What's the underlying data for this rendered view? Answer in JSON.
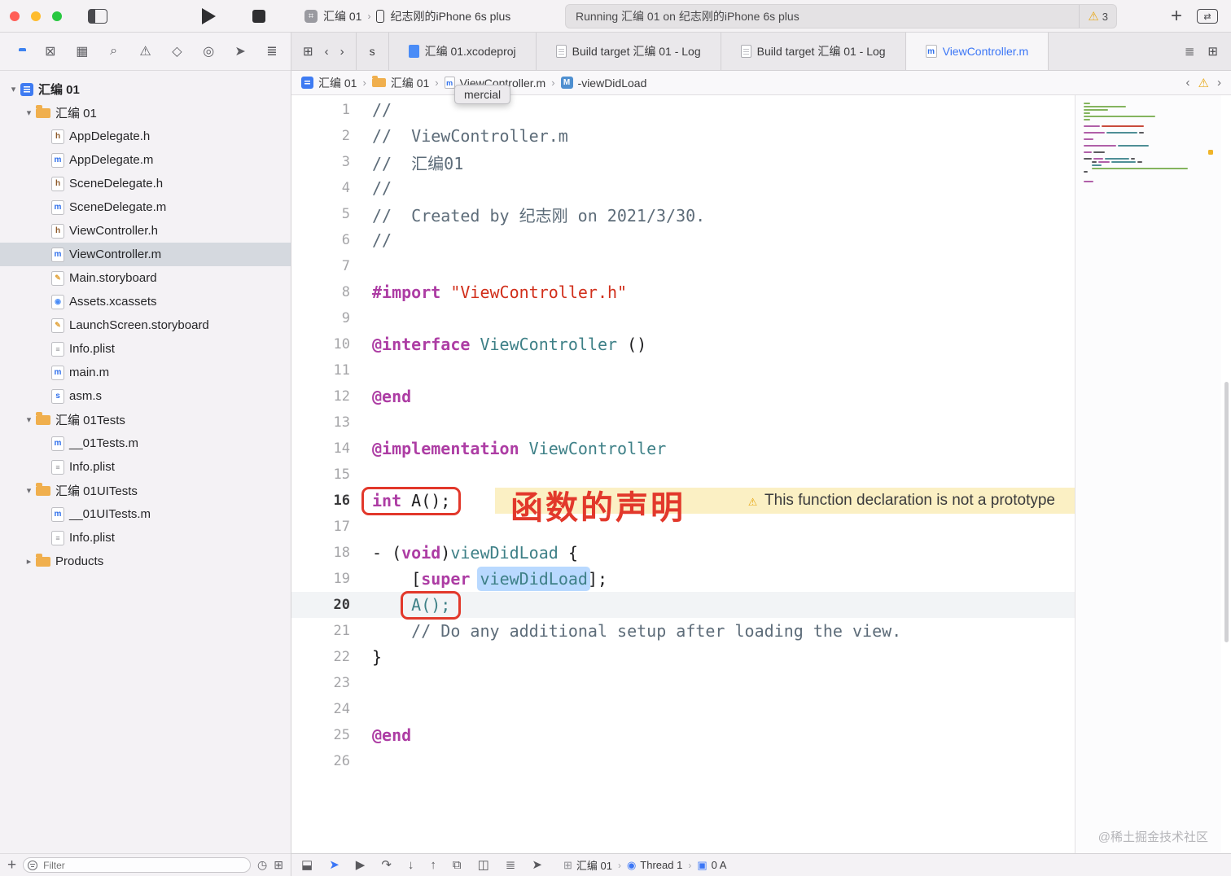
{
  "window": {
    "scheme": "汇编 01",
    "device": "纪志刚的iPhone 6s plus",
    "status_text": "Running 汇编 01 on 纪志刚的iPhone 6s plus",
    "warning_count": "3"
  },
  "navigator_icons": [
    {
      "name": "project-navigator-icon",
      "shape": "folder",
      "active": true
    },
    {
      "name": "source-control-navigator-icon",
      "glyph": "⊠"
    },
    {
      "name": "symbol-navigator-icon",
      "glyph": "▦"
    },
    {
      "name": "find-navigator-icon",
      "glyph": "⌕"
    },
    {
      "name": "issue-navigator-icon",
      "glyph": "⚠"
    },
    {
      "name": "test-navigator-icon",
      "glyph": "◇"
    },
    {
      "name": "debug-navigator-icon",
      "glyph": "◎"
    },
    {
      "name": "breakpoint-navigator-icon",
      "glyph": "➤"
    },
    {
      "name": "report-navigator-icon",
      "glyph": "≣"
    }
  ],
  "tab_bar": {
    "leading_icons": [
      {
        "name": "related-items-icon",
        "glyph": "⊞"
      },
      {
        "name": "back-chevron-icon",
        "glyph": "‹"
      },
      {
        "name": "forward-chevron-icon",
        "glyph": "›"
      }
    ],
    "tabs": [
      {
        "label": "s",
        "icon": "none"
      },
      {
        "label": "汇编 01.xcodeproj",
        "icon": "xcodeproj"
      },
      {
        "label": "Build target 汇编 01 - Log",
        "icon": "log"
      },
      {
        "label": "Build target 汇编 01 - Log",
        "icon": "log"
      },
      {
        "label": "ViewController.m",
        "icon": "mfile",
        "active": true
      }
    ],
    "trailing_icons": [
      {
        "name": "adjust-editor-icon",
        "glyph": "≣"
      },
      {
        "name": "add-editor-icon",
        "glyph": "⊞"
      }
    ]
  },
  "jump_bar": {
    "items": [
      {
        "label": "汇编 01",
        "icon": "project"
      },
      {
        "label": "汇编 01",
        "icon": "folder"
      },
      {
        "label": "ViewController.m",
        "icon": "mfile"
      },
      {
        "label": "-viewDidLoad",
        "icon": "method"
      }
    ],
    "trailing": [
      {
        "name": "previous-issue-icon",
        "glyph": "‹"
      },
      {
        "name": "issue-warning-icon",
        "glyph": "⚠"
      },
      {
        "name": "next-issue-icon",
        "glyph": "›"
      }
    ],
    "tooltip": "mercial"
  },
  "sidebar": {
    "filter_placeholder": "Filter",
    "items": [
      {
        "label": "汇编 01",
        "icon": "project",
        "level": 0,
        "chev": "down",
        "root": true
      },
      {
        "label": "汇编 01",
        "icon": "folder",
        "level": 1,
        "chev": "down"
      },
      {
        "label": "AppDelegate.h",
        "icon": "h",
        "level": 2
      },
      {
        "label": "AppDelegate.m",
        "icon": "m",
        "level": 2
      },
      {
        "label": "SceneDelegate.h",
        "icon": "h",
        "level": 2
      },
      {
        "label": "SceneDelegate.m",
        "icon": "m",
        "level": 2
      },
      {
        "label": "ViewController.h",
        "icon": "h",
        "level": 2
      },
      {
        "label": "ViewController.m",
        "icon": "m",
        "level": 2,
        "selected": true
      },
      {
        "label": "Main.storyboard",
        "icon": "sb",
        "level": 2
      },
      {
        "label": "Assets.xcassets",
        "icon": "ac",
        "level": 2
      },
      {
        "label": "LaunchScreen.storyboard",
        "icon": "sb",
        "level": 2
      },
      {
        "label": "Info.plist",
        "icon": "pl",
        "level": 2
      },
      {
        "label": "main.m",
        "icon": "m",
        "level": 2
      },
      {
        "label": "asm.s",
        "icon": "s",
        "level": 2
      },
      {
        "label": "汇编 01Tests",
        "icon": "folder",
        "level": 1,
        "chev": "down"
      },
      {
        "label": "__01Tests.m",
        "icon": "m",
        "level": 2
      },
      {
        "label": "Info.plist",
        "icon": "pl",
        "level": 2
      },
      {
        "label": "汇编 01UITests",
        "icon": "folder",
        "level": 1,
        "chev": "down"
      },
      {
        "label": "__01UITests.m",
        "icon": "m",
        "level": 2
      },
      {
        "label": "Info.plist",
        "icon": "pl",
        "level": 2
      },
      {
        "label": "Products",
        "icon": "folder",
        "level": 1,
        "chev": "right"
      }
    ]
  },
  "editor": {
    "note": "函数的声明",
    "warning_text": "This function declaration is not a prototype",
    "lines": [
      {
        "n": 1,
        "seg": [
          [
            "//",
            "c"
          ]
        ]
      },
      {
        "n": 2,
        "seg": [
          [
            "//  ViewController.m",
            "c"
          ]
        ]
      },
      {
        "n": 3,
        "seg": [
          [
            "//  汇编01",
            "c"
          ]
        ]
      },
      {
        "n": 4,
        "seg": [
          [
            "//",
            "c"
          ]
        ]
      },
      {
        "n": 5,
        "seg": [
          [
            "//  Created by 纪志刚 on 2021/3/30.",
            "c"
          ]
        ]
      },
      {
        "n": 6,
        "seg": [
          [
            "//",
            "c"
          ]
        ]
      },
      {
        "n": 7,
        "seg": []
      },
      {
        "n": 8,
        "seg": [
          [
            "#import",
            "k"
          ],
          [
            " ",
            "p"
          ],
          [
            "\"ViewController.h\"",
            "s"
          ]
        ]
      },
      {
        "n": 9,
        "seg": []
      },
      {
        "n": 10,
        "seg": [
          [
            "@interface",
            "k"
          ],
          [
            " ",
            "p"
          ],
          [
            "ViewController",
            "t"
          ],
          [
            " ()",
            "p"
          ]
        ]
      },
      {
        "n": 11,
        "seg": []
      },
      {
        "n": 12,
        "seg": [
          [
            "@end",
            "k"
          ]
        ]
      },
      {
        "n": 13,
        "seg": []
      },
      {
        "n": 14,
        "seg": [
          [
            "@implementation",
            "k"
          ],
          [
            " ",
            "p"
          ],
          [
            "ViewController",
            "t"
          ]
        ]
      },
      {
        "n": 15,
        "seg": []
      },
      {
        "n": 16,
        "seg": [
          [
            "int",
            "k"
          ],
          [
            " ",
            "p"
          ],
          [
            "A();",
            "p"
          ]
        ],
        "box": [
          0,
          2
        ],
        "warning": true,
        "emph": true
      },
      {
        "n": 17,
        "seg": []
      },
      {
        "n": 18,
        "seg": [
          [
            "- (",
            "p"
          ],
          [
            "void",
            "k"
          ],
          [
            ")",
            "p"
          ],
          [
            "viewDidLoad",
            "t"
          ],
          [
            " {",
            "p"
          ]
        ]
      },
      {
        "n": 19,
        "seg": [
          [
            "    [",
            "p"
          ],
          [
            "super",
            "k"
          ],
          [
            " ",
            "p"
          ],
          [
            "viewDidLoad",
            "hl"
          ],
          [
            "];",
            "p"
          ]
        ]
      },
      {
        "n": 20,
        "seg": [
          [
            "    ",
            "p"
          ],
          [
            "A();",
            "t"
          ]
        ],
        "box": [
          1,
          1
        ],
        "current": true,
        "emph": true
      },
      {
        "n": 21,
        "seg": [
          [
            "    // Do any additional setup after loading the view.",
            "c"
          ]
        ]
      },
      {
        "n": 22,
        "seg": [
          [
            "}",
            "p"
          ]
        ]
      },
      {
        "n": 23,
        "seg": []
      },
      {
        "n": 24,
        "seg": []
      },
      {
        "n": 25,
        "seg": [
          [
            "@end",
            "k"
          ]
        ]
      },
      {
        "n": 26,
        "seg": []
      }
    ]
  },
  "minimap": {
    "rows": [
      {
        "s": [
          [
            8,
            "g"
          ]
        ]
      },
      {
        "s": [
          [
            52,
            "g"
          ]
        ]
      },
      {
        "s": [
          [
            30,
            "g"
          ]
        ]
      },
      {
        "s": [
          [
            8,
            "g"
          ]
        ]
      },
      {
        "s": [
          [
            88,
            "g"
          ]
        ]
      },
      {
        "s": [
          [
            8,
            "g"
          ]
        ]
      },
      {
        "s": []
      },
      {
        "s": [
          [
            20,
            "k"
          ],
          [
            52,
            "r"
          ]
        ]
      },
      {
        "s": []
      },
      {
        "s": [
          [
            26,
            "k"
          ],
          [
            38,
            "t"
          ],
          [
            6,
            "b"
          ]
        ]
      },
      {
        "s": []
      },
      {
        "s": [
          [
            12,
            "k"
          ]
        ]
      },
      {
        "s": []
      },
      {
        "s": [
          [
            40,
            "k"
          ],
          [
            38,
            "t"
          ]
        ]
      },
      {
        "s": []
      },
      {
        "s": [
          [
            10,
            "k"
          ],
          [
            14,
            "b"
          ]
        ],
        "warn": true
      },
      {
        "s": []
      },
      {
        "s": [
          [
            10,
            "b"
          ],
          [
            12,
            "k"
          ],
          [
            30,
            "t"
          ],
          [
            5,
            "b"
          ]
        ]
      },
      {
        "i": 1,
        "s": [
          [
            6,
            "b"
          ],
          [
            14,
            "k"
          ],
          [
            30,
            "t"
          ],
          [
            6,
            "b"
          ]
        ]
      },
      {
        "i": 1,
        "s": [
          [
            12,
            "t"
          ]
        ]
      },
      {
        "i": 1,
        "s": [
          [
            118,
            "g"
          ]
        ]
      },
      {
        "s": [
          [
            5,
            "b"
          ]
        ]
      },
      {
        "s": []
      },
      {
        "s": []
      },
      {
        "s": [
          [
            12,
            "k"
          ]
        ]
      },
      {
        "s": []
      }
    ]
  },
  "debug_bar": {
    "icons": [
      {
        "name": "toggle-debug-area-icon",
        "glyph": "⬓"
      },
      {
        "name": "breakpoints-toggle-icon",
        "glyph": "➤",
        "color": "#3B76F6"
      },
      {
        "name": "continue-icon",
        "glyph": "▶"
      },
      {
        "name": "step-over-icon",
        "glyph": "↷"
      },
      {
        "name": "step-into-icon",
        "glyph": "↓"
      },
      {
        "name": "step-out-icon",
        "glyph": "↑"
      },
      {
        "name": "view-hierarchy-icon",
        "glyph": "⧉"
      },
      {
        "name": "memory-graph-icon",
        "glyph": "◫"
      },
      {
        "name": "environment-overrides-icon",
        "glyph": "≣"
      },
      {
        "name": "simulate-location-icon",
        "glyph": "➤"
      }
    ],
    "breadcrumb": [
      {
        "label": "汇编 01",
        "glyph": "⊞",
        "color": "#8E8E93"
      },
      {
        "label": "Thread 1",
        "glyph": "◉",
        "color": "#3B76F6"
      },
      {
        "label": "0 A",
        "glyph": "▣",
        "color": "#3B76F6"
      }
    ]
  },
  "watermark": "@稀土掘金技术社区",
  "colors": {
    "keyword": "#AD3DA4",
    "type": "#3E8087",
    "string": "#D12F1B",
    "comment": "#5D6C79",
    "selection": "#B9D9FF",
    "note": "#E2382B",
    "accent": "#3B76F6",
    "mm_g": "#84B45E",
    "mm_k": "#B05FA8",
    "mm_t": "#4E8E96",
    "mm_r": "#C94B3C",
    "mm_b": "#5A5A5E"
  }
}
